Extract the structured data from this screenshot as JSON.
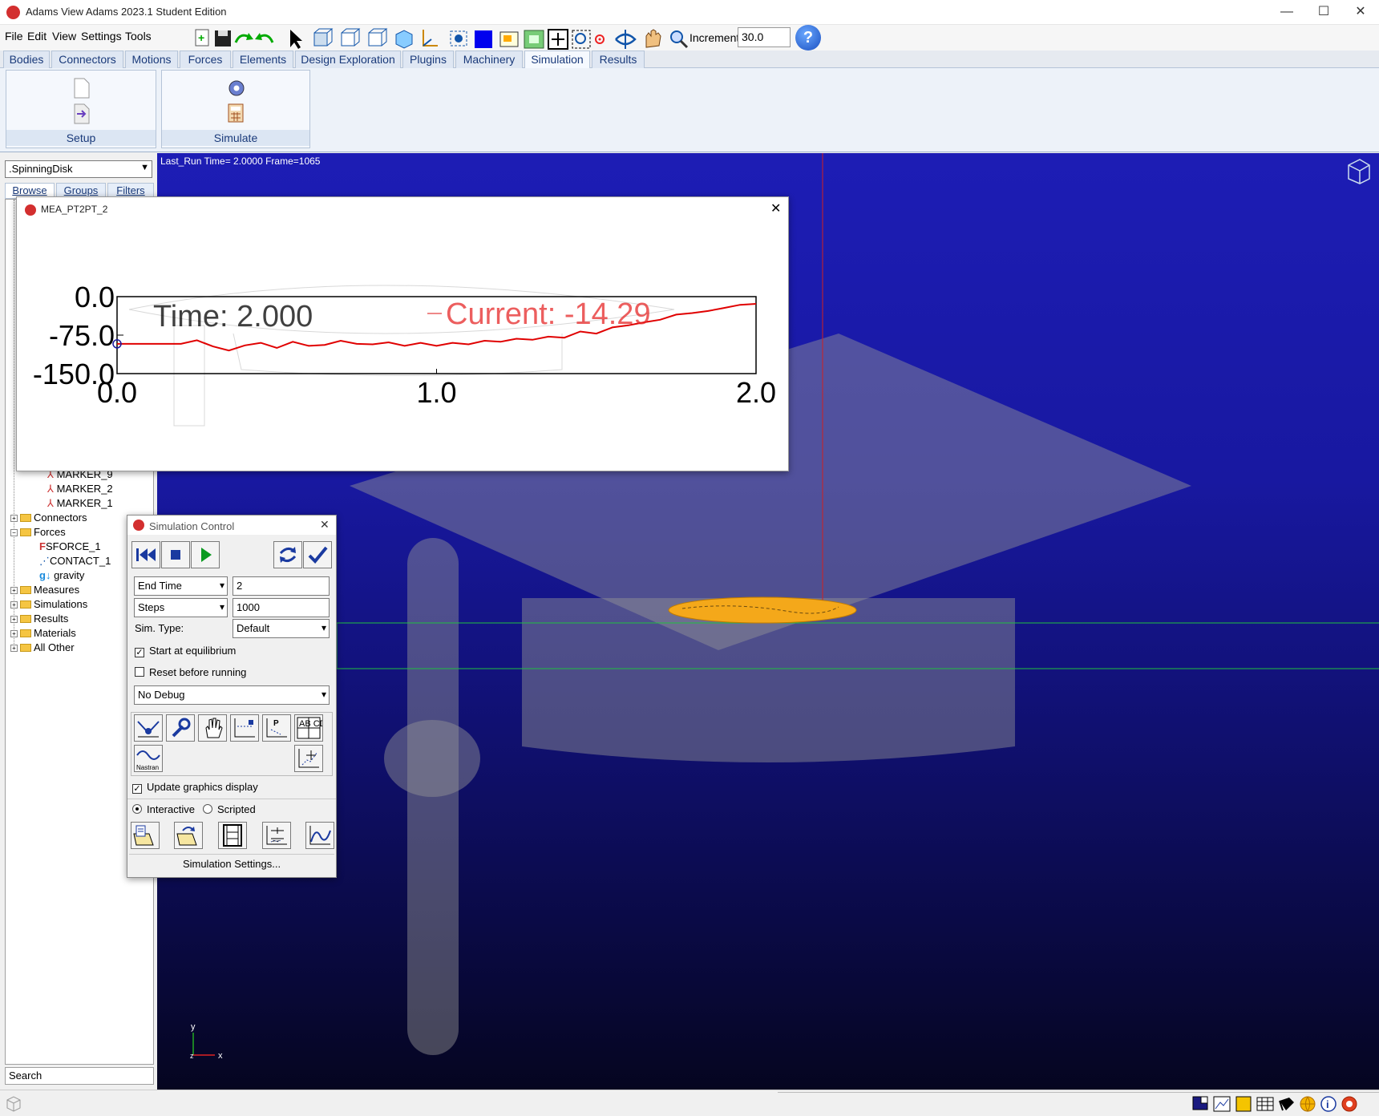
{
  "window": {
    "title": "Adams  View Adams 2023.1 Student Edition",
    "controls": [
      "—",
      "☐",
      "✕"
    ]
  },
  "menu": [
    "File",
    "Edit",
    "View",
    "Settings",
    "Tools"
  ],
  "toolbar": {
    "icons": [
      "new-model-icon",
      "save-icon",
      "redo-icon",
      "undo-icon",
      "select-pointer-icon",
      "front-view-icon",
      "top-view-icon",
      "right-view-icon",
      "iso-view-icon",
      "triad-icon",
      "render-mode-icon",
      "color-icon",
      "view-layout-icon",
      "fit-icon",
      "zoom-fit-icon",
      "zoom-box-icon",
      "center-icon",
      "rotate-icon",
      "pan-icon",
      "zoom-icon"
    ],
    "increment_label": "Increment",
    "increment_value": "30.0",
    "help_label": "?"
  },
  "ribbon_tabs": [
    {
      "label": "Bodies"
    },
    {
      "label": "Connectors"
    },
    {
      "label": "Motions"
    },
    {
      "label": "Forces"
    },
    {
      "label": "Elements"
    },
    {
      "label": "Design Exploration"
    },
    {
      "label": "Plugins"
    },
    {
      "label": "Machinery"
    },
    {
      "label": "Simulation",
      "active": true
    },
    {
      "label": "Results"
    }
  ],
  "ribbon_groups": [
    {
      "label": "Setup",
      "icons": [
        "document-icon",
        "import-icon"
      ]
    },
    {
      "label": "Simulate",
      "icons": [
        "gear-icon",
        "calculator-icon"
      ]
    }
  ],
  "left_panel": {
    "model": ".SpinningDisk",
    "browser_tabs": [
      "Browse",
      "Groups",
      "Filters"
    ],
    "tree_markers": [
      "MARKER_9",
      "MARKER_2",
      "MARKER_1"
    ],
    "tree": [
      {
        "label": "Connectors",
        "type": "folder"
      },
      {
        "label": "Forces",
        "type": "folder",
        "expanded": true
      },
      {
        "label": "SFORCE_1",
        "type": "child"
      },
      {
        "label": "CONTACT_1",
        "type": "child"
      },
      {
        "label": "gravity",
        "type": "child"
      },
      {
        "label": "Measures",
        "type": "folder"
      },
      {
        "label": "Simulations",
        "type": "folder"
      },
      {
        "label": "Results",
        "type": "folder"
      },
      {
        "label": "Materials",
        "type": "folder"
      },
      {
        "label": "All Other",
        "type": "folder"
      }
    ],
    "search_placeholder": "Search"
  },
  "viewport": {
    "run_info": "Last_Run   Time= 2.0000  Frame=1065",
    "axis_y": "y",
    "axis_x": "x",
    "axis_z": "z",
    "background_top": "#1d1db5",
    "background_bottom": "#050520"
  },
  "plot_window": {
    "title": "MEA_PT2PT_2",
    "close": "✕",
    "time_label": "Time:  2.000",
    "current_label": "Current:  -14.29",
    "line_color": "#e00000"
  },
  "chart_data": {
    "type": "line",
    "title": "",
    "xlabel": "",
    "ylabel": "",
    "xlim": [
      0.0,
      2.0
    ],
    "ylim": [
      -150.0,
      0.0
    ],
    "x_ticks": [
      "0.0",
      "1.0",
      "2.0"
    ],
    "y_ticks": [
      "0.0",
      "-75.0",
      "-150.0"
    ],
    "series": [
      {
        "x": [
          0.0,
          0.1,
          0.2,
          0.25,
          0.3,
          0.35,
          0.4,
          0.45,
          0.5,
          0.55,
          0.6,
          0.65,
          0.7,
          0.75,
          0.8,
          0.85,
          0.9,
          0.95,
          1.0,
          1.05,
          1.1,
          1.15,
          1.2,
          1.25,
          1.3,
          1.35,
          1.4,
          1.45,
          1.5,
          1.55,
          1.6,
          1.65,
          1.7,
          1.75,
          1.8,
          1.85,
          1.9,
          1.95,
          2.0
        ],
        "y": [
          -92,
          -92,
          -92,
          -85,
          -97,
          -105,
          -95,
          -90,
          -100,
          -88,
          -96,
          -94,
          -86,
          -92,
          -93,
          -89,
          -96,
          -90,
          -96,
          -90,
          -93,
          -86,
          -88,
          -82,
          -84,
          -78,
          -80,
          -68,
          -72,
          -60,
          -56,
          -50,
          -45,
          -35,
          -32,
          -28,
          -22,
          -16,
          -14
        ]
      }
    ]
  },
  "sim_control": {
    "title": "Simulation Control",
    "close": "✕",
    "end_time_mode": "End Time",
    "end_time_value": "2",
    "steps_mode": "Steps",
    "steps_value": "1000",
    "sim_type_label": "Sim. Type:",
    "sim_type_value": "Default",
    "start_equilibrium": "Start at equilibrium",
    "reset_before": "Reset before running",
    "debug_value": "No Debug",
    "nastran_label": "Nastran",
    "abcd_label": "AB CD",
    "update_graphics": "Update graphics display",
    "interactive": "Interactive",
    "scripted": "Scripted",
    "settings_button": "Simulation Settings..."
  },
  "status_icons": [
    "view-icon",
    "plot-icon",
    "color-icon",
    "table-icon",
    "cursor-icon",
    "globe-icon",
    "info-icon",
    "stop-icon"
  ]
}
